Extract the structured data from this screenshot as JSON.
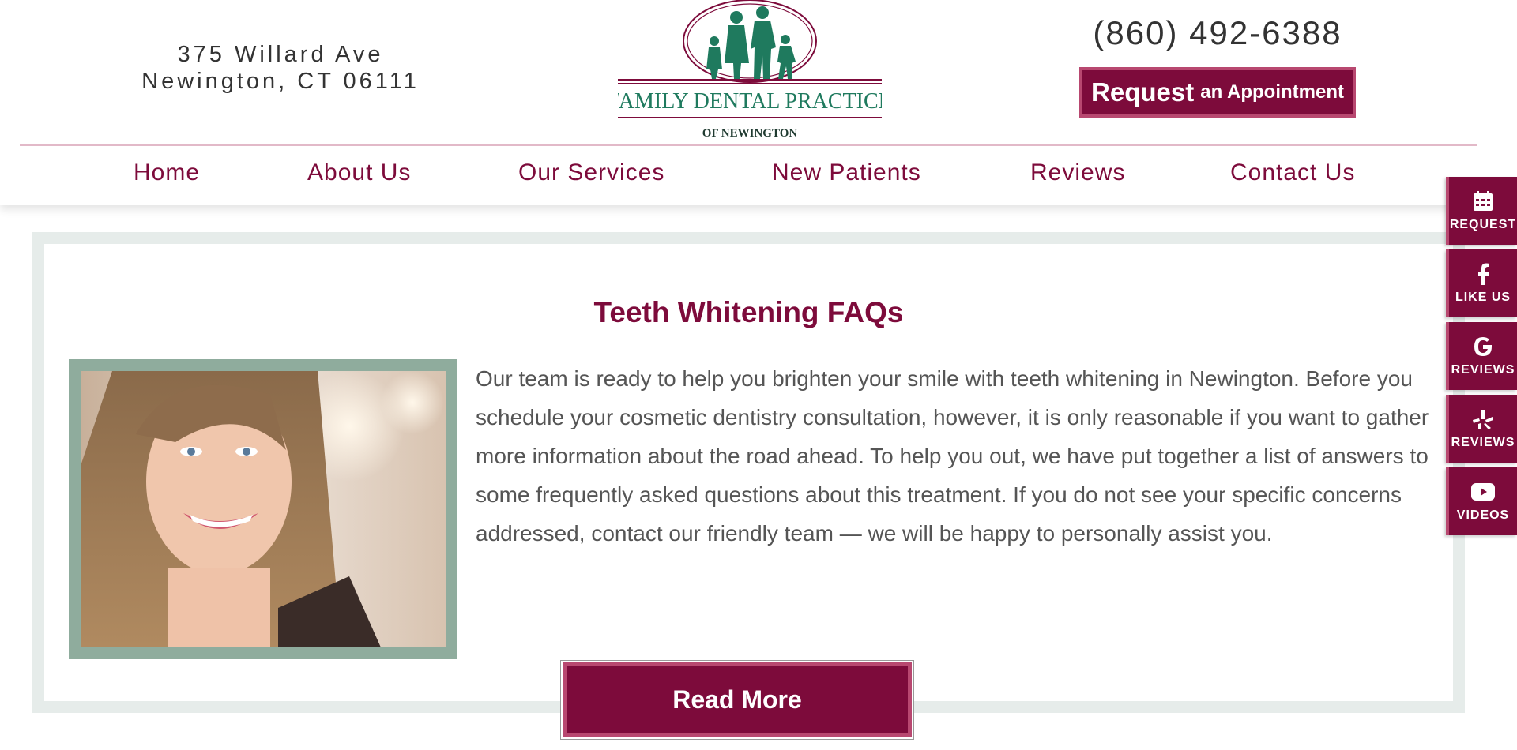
{
  "header": {
    "address_line1": "375 Willard Ave",
    "address_line2": "Newington, CT 06111",
    "logo_name": "FAMILY DENTAL PRACTICE",
    "logo_sub": "OF NEWINGTON",
    "phone": "(860) 492-6388",
    "request_big": "Request",
    "request_small": "an Appointment"
  },
  "nav": [
    "Home",
    "About Us",
    "Our Services",
    "New Patients",
    "Reviews",
    "Contact Us"
  ],
  "main": {
    "title": "Teeth Whitening FAQs",
    "body": "Our team is ready to help you brighten your smile with teeth whitening in Newington. Before you schedule your cosmetic dentistry consultation, however, it is only reasonable if you want to gather more information about the road ahead. To help you out, we have put together a list of answers to some frequently asked questions about this treatment. If you do not see your specific concerns addressed, contact our friendly team — we will be happy to personally assist you.",
    "read_more": "Read More"
  },
  "side": [
    {
      "label": "REQUEST",
      "icon": "calendar-icon"
    },
    {
      "label": "LIKE US",
      "icon": "facebook-icon"
    },
    {
      "label": "REVIEWS",
      "icon": "google-icon"
    },
    {
      "label": "REVIEWS",
      "icon": "yelp-icon"
    },
    {
      "label": "VIDEOS",
      "icon": "youtube-icon"
    }
  ],
  "colors": {
    "brand": "#7d0b3b",
    "brand_light": "#b84870",
    "photo_border": "#8fac9d",
    "logo_green": "#1f7a5e"
  }
}
